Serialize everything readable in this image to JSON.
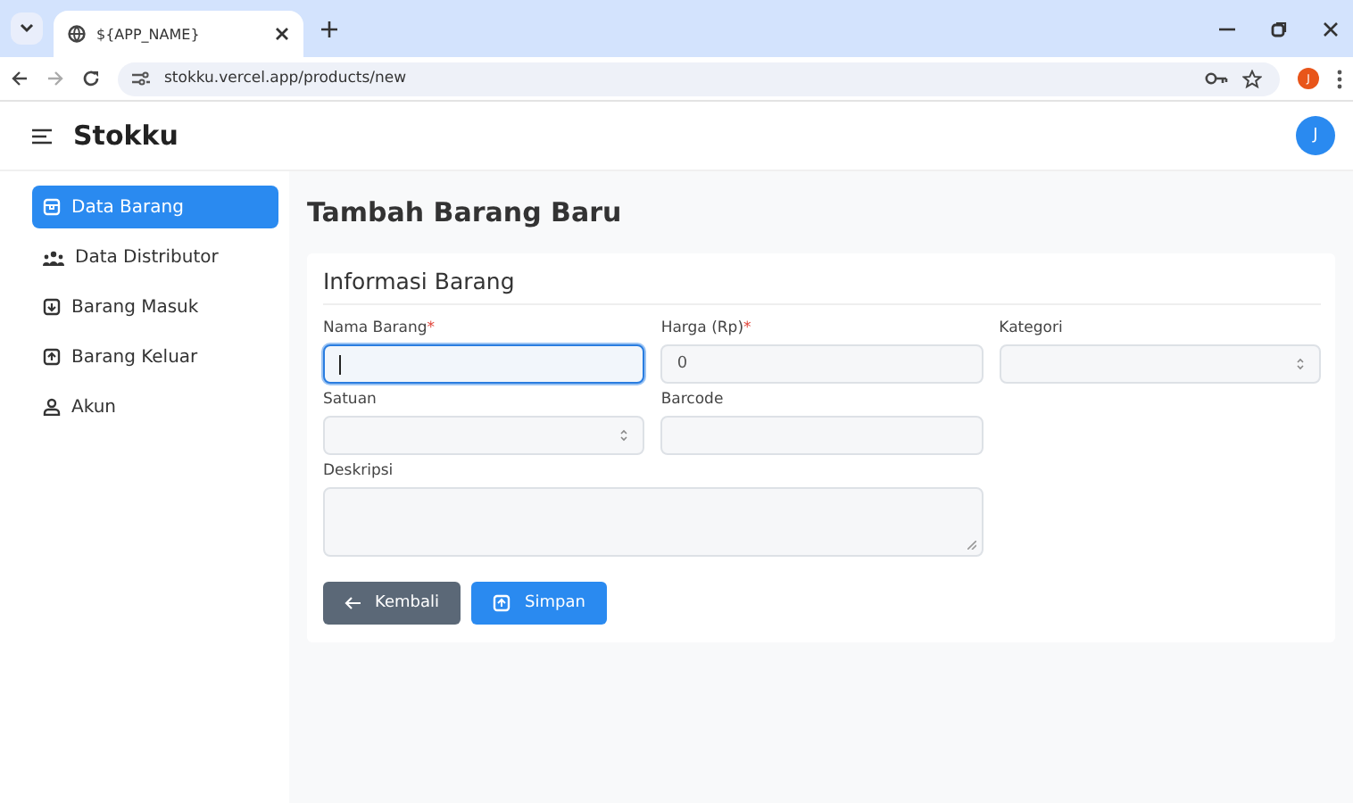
{
  "browser": {
    "tab_title": "${APP_NAME}",
    "url": "stokku.vercel.app/products/new",
    "profile_initial": "J"
  },
  "app": {
    "title": "Stokku",
    "avatar_initial": "J"
  },
  "sidebar": {
    "items": [
      {
        "label": "Data Barang",
        "selected": true
      },
      {
        "label": "Data Distributor",
        "selected": false
      },
      {
        "label": "Barang Masuk",
        "selected": false
      },
      {
        "label": "Barang Keluar",
        "selected": false
      },
      {
        "label": "Akun",
        "selected": false
      }
    ]
  },
  "page_title": "Tambah Barang Baru",
  "form": {
    "section_title": "Informasi Barang",
    "fields": [
      {
        "kind": "text",
        "label": "Nama Barang",
        "required_mark": "*",
        "focused": true
      },
      {
        "kind": "text",
        "label": "Harga (Rp)",
        "required_mark": "*",
        "value": "0",
        "focused": false
      },
      {
        "kind": "select",
        "label": "Kategori",
        "focused": false
      },
      {
        "kind": "select",
        "label": "Satuan",
        "focused": false
      },
      {
        "kind": "text",
        "label": "Barcode",
        "focused": false
      },
      {
        "kind": "textarea",
        "label": "Deskripsi",
        "focused": false
      }
    ],
    "buttons": [
      {
        "kind": "back",
        "label": "Kembali"
      },
      {
        "kind": "save",
        "label": "Simpan"
      }
    ]
  }
}
